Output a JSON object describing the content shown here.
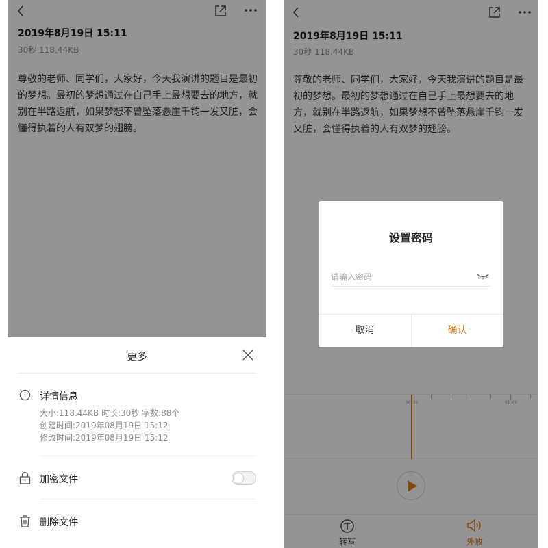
{
  "note": {
    "datetime": "2019年8月19日 15:11",
    "meta": "30秒 118.44KB",
    "body": "尊敬的老师、同学们，大家好，今天我演讲的题目是最初的梦想。最初的梦想通过在自己手上最想要去的地方，就别在半路返航，如果梦想不曾坠落悬崖千钧一发又脏，会懂得执着的人有双梦的翅膀。"
  },
  "more_sheet": {
    "title": "更多",
    "details": {
      "label": "详情信息",
      "size_line": "大小:118.44KB 时长:30秒 字数:88个",
      "created_line": "创建时间:2019年08月19日 15:12",
      "modified_line": "修改时间:2019年08月19日 15:12"
    },
    "encrypt": {
      "label": "加密文件",
      "enabled": false
    },
    "delete": {
      "label": "删除文件"
    }
  },
  "password_dialog": {
    "title": "设置密码",
    "placeholder": "请输入密码",
    "cancel_label": "取消",
    "confirm_label": "确认"
  },
  "waveform": {
    "time_labels": [
      "00:30",
      "01:00"
    ]
  },
  "tabs": [
    {
      "label": "转写",
      "icon": "transcribe-icon"
    },
    {
      "label": "外放",
      "icon": "speaker-icon"
    }
  ],
  "colors": {
    "accent": "#e07a1a",
    "overlay": "rgba(0,0,0,0.42)",
    "text_primary": "#222222",
    "text_secondary": "#8f8f8f"
  }
}
